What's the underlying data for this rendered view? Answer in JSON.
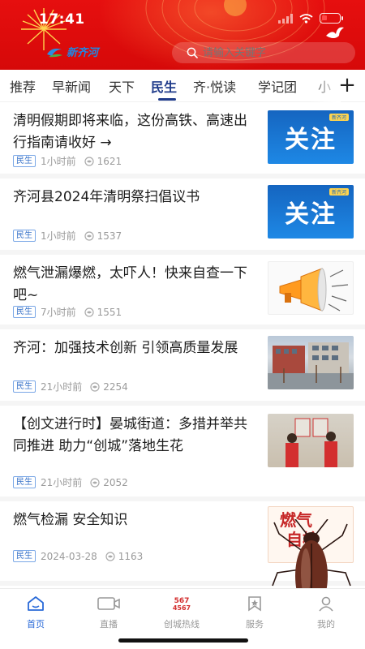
{
  "status_bar": {
    "time": "17:41"
  },
  "header": {
    "logo_text": "新齐河",
    "search_placeholder": "请输入关键字",
    "accent_color": "#e60f0f"
  },
  "tabs": {
    "items": [
      {
        "label": "推荐",
        "active": false
      },
      {
        "label": "早新闻",
        "active": false
      },
      {
        "label": "天下",
        "active": false
      },
      {
        "label": "民生",
        "active": true
      },
      {
        "label": "齐·悦读",
        "active": false
      },
      {
        "label": "学记团",
        "active": false
      },
      {
        "label": "小",
        "active": false
      }
    ],
    "add_icon": "plus-icon"
  },
  "articles": [
    {
      "title": "清明假期即将来临，这份高铁、高速出行指南请收好 →",
      "tag": "民生",
      "time": "1小时前",
      "views": "1621",
      "thumb_text": "关注",
      "thumb_badge": "新齐河"
    },
    {
      "title": "齐河县2024年清明祭扫倡议书",
      "tag": "民生",
      "time": "1小时前",
      "views": "1537",
      "thumb_text": "关注",
      "thumb_badge": "新齐河"
    },
    {
      "title": "燃气泄漏爆燃，太吓人！快来自查一下吧~",
      "tag": "民生",
      "time": "7小时前",
      "views": "1551"
    },
    {
      "title": "齐河：加强技术创新  引领高质量发展",
      "tag": "民生",
      "time": "21小时前",
      "views": "2254"
    },
    {
      "title": "【创文进行时】晏城街道：多措并举共同推进  助力“创城”落地生花",
      "tag": "民生",
      "time": "21小时前",
      "views": "2052"
    },
    {
      "title": "燃气检漏  安全知识",
      "tag": "民生",
      "time": "2024-03-28",
      "views": "1163",
      "thumb_text_1": "燃气",
      "thumb_text_2": "自检"
    }
  ],
  "bottom_nav": {
    "items": [
      {
        "label": "首页",
        "icon": "home-icon",
        "active": true
      },
      {
        "label": "直播",
        "icon": "video-camera-icon",
        "active": false
      },
      {
        "label": "创城热线",
        "icon": "hotline-icon",
        "active": false,
        "badge_top": "567",
        "badge_bottom": "4567"
      },
      {
        "label": "服务",
        "icon": "bookmark-star-icon",
        "active": false
      },
      {
        "label": "我的",
        "icon": "user-icon",
        "active": false
      }
    ]
  }
}
